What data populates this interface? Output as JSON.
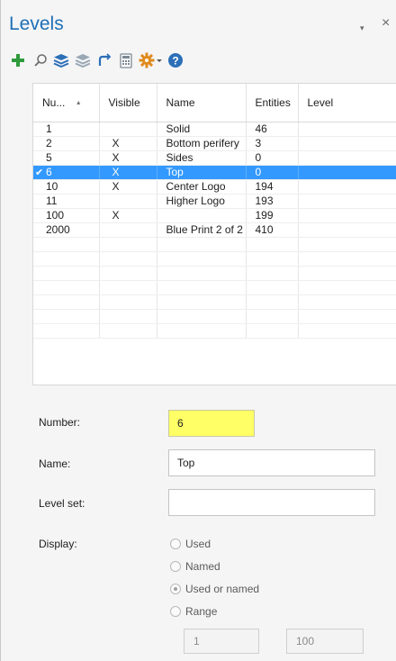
{
  "panel": {
    "title": "Levels",
    "pin_glyph": "▾",
    "close_glyph": "×"
  },
  "toolbar": {
    "icons": [
      "add-icon",
      "search-icon",
      "layers-on-icon",
      "layers-off-icon",
      "undo-icon",
      "calculator-icon",
      "gear-icon",
      "dropdown-arrow-icon",
      "help-icon"
    ],
    "colors": {
      "add": "#2e9b3a",
      "search": "#6b6b6b",
      "layers_on": "#2c6fb7",
      "layers_off": "#9aa7b5",
      "undo": "#2c6fb7",
      "calculator": "#7c8793",
      "gear": "#e08a1c",
      "help": "#2c6fb7"
    }
  },
  "grid": {
    "columns": [
      "Nu...",
      "Visible",
      "Name",
      "Entities",
      "Level"
    ],
    "sort_glyph": "▲",
    "rows": [
      {
        "number": "1",
        "visible": "",
        "name": "Solid",
        "entities": "46",
        "level": ""
      },
      {
        "number": "2",
        "visible": "X",
        "name": "Bottom perifery",
        "entities": "3",
        "level": ""
      },
      {
        "number": "5",
        "visible": "X",
        "name": "Sides",
        "entities": "0",
        "level": ""
      },
      {
        "number": "6",
        "visible": "X",
        "name": "Top",
        "entities": "0",
        "level": "",
        "selected": true,
        "check": "✔"
      },
      {
        "number": "10",
        "visible": "X",
        "name": "Center Logo",
        "entities": "194",
        "level": ""
      },
      {
        "number": "11",
        "visible": "",
        "name": "Higher Logo",
        "entities": "193",
        "level": ""
      },
      {
        "number": "100",
        "visible": "X",
        "name": "",
        "entities": "199",
        "level": ""
      },
      {
        "number": "2000",
        "visible": "",
        "name": "Blue Print 2 of 2",
        "entities": "410",
        "level": ""
      }
    ],
    "selected_color": "#3399ff"
  },
  "form": {
    "number_label": "Number:",
    "number_value": "6",
    "name_label": "Name:",
    "name_value": "Top",
    "levelset_label": "Level set:",
    "levelset_value": "",
    "display_label": "Display:",
    "options": [
      {
        "label": "Used",
        "checked": false
      },
      {
        "label": "Named",
        "checked": false
      },
      {
        "label": "Used or named",
        "checked": true
      },
      {
        "label": "Range",
        "checked": false
      }
    ],
    "range_from": "1",
    "range_to": "100"
  }
}
